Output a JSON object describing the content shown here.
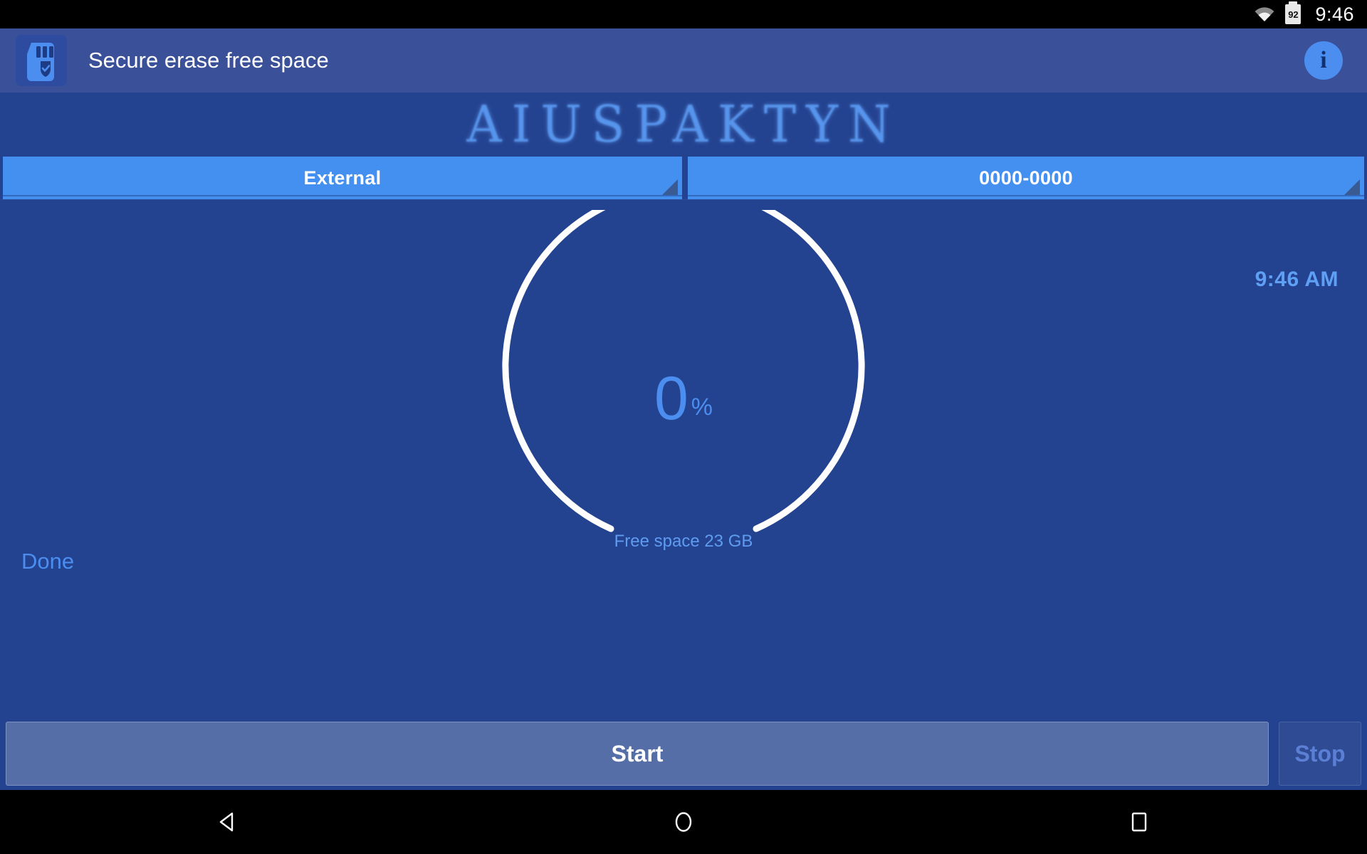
{
  "status_bar": {
    "wifi_icon": "wifi-icon",
    "battery_icon": "battery-icon",
    "battery_level": "92",
    "time": "9:46"
  },
  "action_bar": {
    "app_icon": "sd-card-shield-icon",
    "title": "Secure erase free space",
    "info_button": {
      "icon": "info-icon",
      "label": "i"
    }
  },
  "logo_banner": {
    "text": "AIUSPAKTYN"
  },
  "spinners": [
    {
      "name": "storage-location-spinner",
      "value": "External",
      "caret_icon": "dropdown-caret-icon"
    },
    {
      "name": "volume-id-spinner",
      "value": "0000-0000",
      "caret_icon": "dropdown-caret-icon"
    }
  ],
  "main": {
    "clock": "9:46 AM",
    "progress": {
      "value": "0",
      "unit": "%",
      "percent": 0,
      "arc_color": "#ffffff",
      "text_color": "#4b8ef0"
    },
    "free_space": "Free space 23 GB",
    "status": "Done"
  },
  "buttons": {
    "start": "Start",
    "stop": "Stop"
  },
  "nav_bar": {
    "back": "back-triangle-icon",
    "home": "home-circle-icon",
    "recents": "recents-square-icon"
  },
  "colors": {
    "accent": "#4b8ef0",
    "app_bar": "#3a5199",
    "background": "#23428f",
    "spinner": "#4490f0"
  }
}
